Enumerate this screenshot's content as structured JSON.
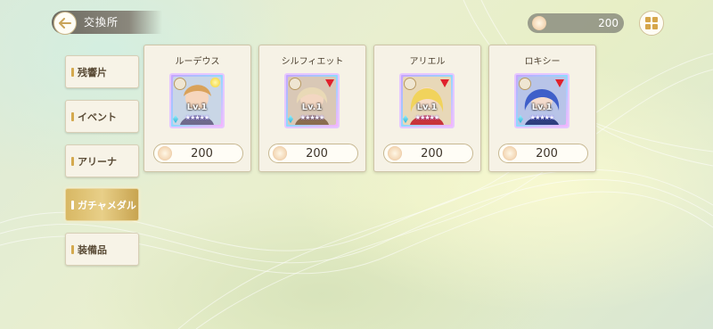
{
  "header": {
    "title": "交換所"
  },
  "currency": {
    "amount": "200",
    "icon": "medal-coin-icon"
  },
  "sidebar": {
    "items": [
      {
        "label": "残響片",
        "active": false
      },
      {
        "label": "イベント",
        "active": false
      },
      {
        "label": "アリーナ",
        "active": false
      },
      {
        "label": "ガチャメダル",
        "active": true
      },
      {
        "label": "装備品",
        "active": false
      }
    ]
  },
  "cards": [
    {
      "name": "ルーデウス",
      "level": "Lv.1",
      "stars": "★★★★★",
      "price": "200",
      "element": "yellow-circle",
      "hair": "#d9a25a",
      "bg": "#c9d6e6"
    },
    {
      "name": "シルフィエット",
      "level": "Lv.1",
      "stars": "★★★★★",
      "price": "200",
      "element": "red-triangle",
      "hair": "#e9d9b6",
      "bg": "#d9c8b6"
    },
    {
      "name": "アリエル",
      "level": "Lv.1",
      "stars": "★★★★★",
      "price": "200",
      "element": "red-triangle",
      "hair": "#f1d35c",
      "bg": "#e8d8b8"
    },
    {
      "name": "ロキシー",
      "level": "Lv.1",
      "stars": "★★★★★",
      "price": "200",
      "element": "red-triangle",
      "hair": "#3f5fc9",
      "bg": "#b8c4e8"
    }
  ],
  "colors": {
    "accent": "#d8b864",
    "card_bg": "#f6f2e6",
    "text_dark": "#4d4130"
  }
}
